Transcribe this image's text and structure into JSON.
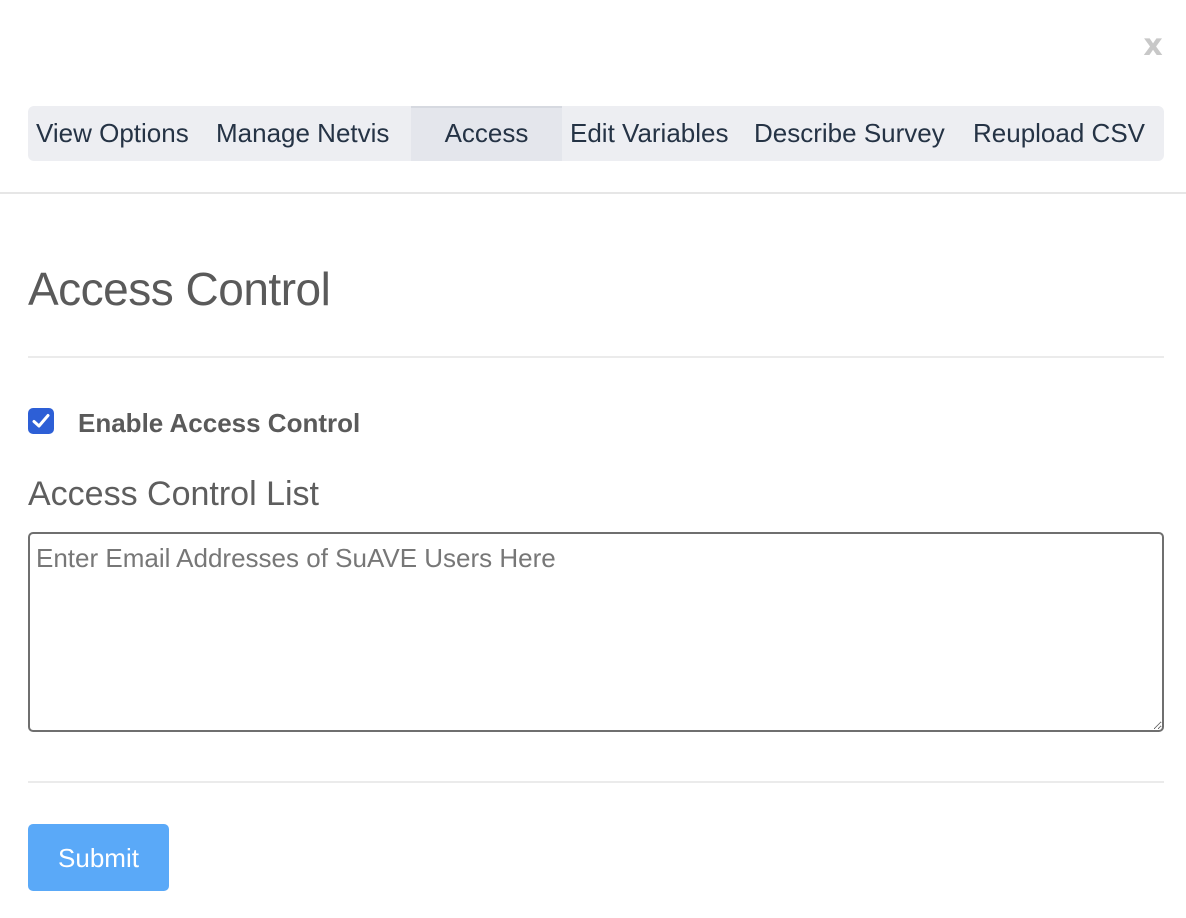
{
  "dialog": {
    "close_label": "x"
  },
  "tabs": [
    {
      "label": "View Options",
      "active": false
    },
    {
      "label": "Manage Netvis",
      "active": false
    },
    {
      "label": "Access",
      "active": true
    },
    {
      "label": "Edit Variables",
      "active": false
    },
    {
      "label": "Describe Survey",
      "active": false
    },
    {
      "label": "Reupload CSV",
      "active": false
    }
  ],
  "access": {
    "title": "Access Control",
    "enable_label": "Enable Access Control",
    "enable_checked": true,
    "list_label": "Access Control List",
    "list_placeholder": "Enter Email Addresses of SuAVE Users Here",
    "list_value": "",
    "submit_label": "Submit"
  },
  "colors": {
    "accent": "#2d5fd6",
    "submit": "#5aa9f8",
    "tab_text": "#253345",
    "tabbar_bg": "#edeef2"
  },
  "icons": {
    "close": "close-icon",
    "check": "check-icon"
  }
}
